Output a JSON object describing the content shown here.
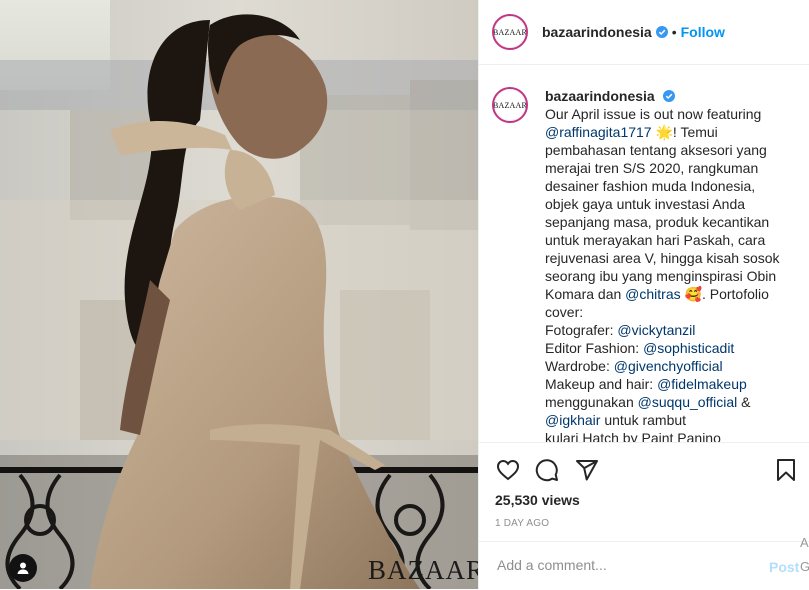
{
  "media": {
    "watermark": "BAZAAR",
    "tag_icon": "user-tag-icon"
  },
  "header": {
    "avatar_text": "BAZAAR",
    "username": "bazaarindonesia",
    "separator": "•",
    "follow_label": "Follow",
    "verified_icon": "verified-badge-icon"
  },
  "caption": {
    "avatar_text": "BAZAAR",
    "username": "bazaarindonesia",
    "lines": [
      {
        "text": "Our April issue is out now featuring"
      },
      {
        "mention": "@raffinagita1717",
        "after": " 🌟! Temui"
      },
      {
        "text": "pembahasan tentang aksesori yang"
      },
      {
        "text": "merajai tren S/S 2020, rangkuman"
      },
      {
        "text": "desainer fashion muda Indonesia,"
      },
      {
        "text": "objek gaya untuk investasi Anda"
      },
      {
        "text": "sepanjang masa, produk kecantikan"
      },
      {
        "text": "untuk merayakan hari Paskah, cara"
      },
      {
        "text": "rejuvenasi area V, hingga kisah sosok"
      },
      {
        "text": "seorang ibu yang menginspirasi Obin"
      },
      {
        "before": "Komara dan ",
        "mention": "@chitras",
        "after": " 🥰. Portofolio"
      },
      {
        "text": "cover:"
      },
      {
        "before": "Fotografer: ",
        "mention": "@vickytanzil"
      },
      {
        "before": "Editor Fashion: ",
        "mention": "@sophisticadit"
      },
      {
        "before": "Wardrobe: ",
        "mention": "@givenchyofficial"
      },
      {
        "before": "Makeup and hair: ",
        "mention": "@fidelmakeup"
      },
      {
        "before": "menggunakan ",
        "mention": "@suqqu_official",
        "after": " &"
      },
      {
        "mention": "@igkhair",
        "after": " untuk rambut"
      },
      {
        "text": "kulari Hatch by Paint Panino"
      }
    ]
  },
  "actions": {
    "like_icon": "heart-icon",
    "comment_icon": "comment-bubble-icon",
    "share_icon": "paper-plane-icon",
    "save_icon": "bookmark-icon"
  },
  "stats": {
    "views": "25,530 views",
    "time_ago": "1 DAY AGO"
  },
  "comment_box": {
    "placeholder": "Add a comment...",
    "post_label": "Post"
  },
  "edge": {
    "char1": "A",
    "char2": "G"
  },
  "colors": {
    "accent": "#0095f6",
    "post_disabled": "#b2dffc",
    "mention": "#00376b",
    "muted": "#8e8e8e"
  }
}
